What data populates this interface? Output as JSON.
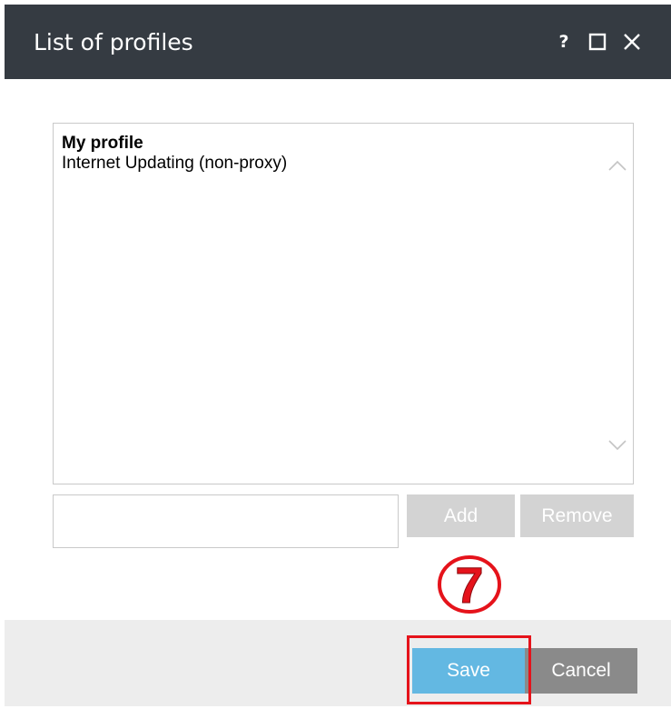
{
  "window": {
    "title": "List of profiles",
    "help_label": "?"
  },
  "profiles": {
    "items": [
      {
        "label": "My profile",
        "bold": true
      },
      {
        "label": "Internet Updating (non-proxy)",
        "bold": false
      }
    ]
  },
  "editor": {
    "input_value": "",
    "add_label": "Add",
    "remove_label": "Remove"
  },
  "footer": {
    "save_label": "Save",
    "cancel_label": "Cancel"
  },
  "annotation": {
    "step_number": "7",
    "color": "#e5131b"
  },
  "colors": {
    "titlebar": "#353b42",
    "save_button": "#63b8e2",
    "cancel_button": "#8a8a8a",
    "disabled_button": "#d3d3d3"
  },
  "icons": {
    "help": "question-mark-icon",
    "maximize": "maximize-icon",
    "close": "close-icon",
    "scroll_up": "chevron-up-icon",
    "scroll_down": "chevron-down-icon"
  }
}
